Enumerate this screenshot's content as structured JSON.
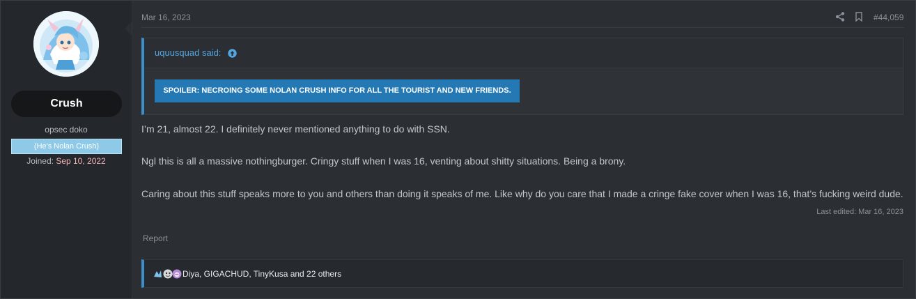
{
  "user": {
    "name": "Crush",
    "title": "opsec doko",
    "banner": "(He's Nolan Crush)",
    "joined_label": "Joined:",
    "joined_date": "Sep 10, 2022"
  },
  "post": {
    "date": "Mar 16, 2023",
    "number": "#44,059",
    "quote": {
      "author": "uquusquad said:",
      "spoiler_label": "SPOILER: NECROING SOME NOLAN CRUSH INFO FOR ALL THE TOURIST AND NEW FRIENDS."
    },
    "paragraphs": [
      "I’m 21, almost 22. I definitely never mentioned anything to do with SSN.",
      "Ngl this is all a massive nothingburger. Cringy stuff when I was 16, venting about shitty situations. Being a brony.",
      "Caring about this stuff speaks more to you and others than doing it speaks of me. Like why do you care that I made a cringe fake cover when I was 16, that’s fucking weird dude."
    ],
    "last_edited": "Last edited: Mar 16, 2023",
    "report_label": "Report",
    "reactions_text": "Diya, GIGACHUD, TinyKusa and 22 others"
  },
  "icons": {
    "share": "share-icon",
    "bookmark": "bookmark-icon",
    "quote_up": "arrow-up-circle-icon",
    "reactions": "reaction-emoji-icons"
  },
  "colors": {
    "accent": "#3c8ec9",
    "link": "#54a6e0",
    "spoiler": "#2479b4",
    "banner": "#8ecae8",
    "joined_date": "#f5b6b6"
  }
}
